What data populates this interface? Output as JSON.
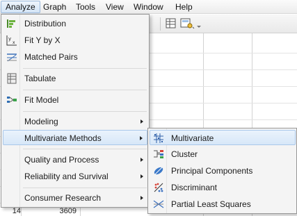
{
  "menubar": {
    "items": [
      "Analyze",
      "Graph",
      "Tools",
      "View",
      "Window",
      "Help"
    ]
  },
  "analyze_menu": {
    "items": [
      {
        "label": "Distribution",
        "icon": "distribution-icon"
      },
      {
        "label": "Fit Y by X",
        "icon": "fit-y-by-x-icon"
      },
      {
        "label": "Matched Pairs",
        "icon": "matched-pairs-icon"
      },
      {
        "label": "Tabulate",
        "icon": "tabulate-icon"
      },
      {
        "label": "Fit Model",
        "icon": "fit-model-icon"
      },
      {
        "label": "Modeling",
        "submenu": true
      },
      {
        "label": "Multivariate Methods",
        "submenu": true,
        "highlighted": true
      },
      {
        "label": "Quality and Process",
        "submenu": true
      },
      {
        "label": "Reliability and Survival",
        "submenu": true
      },
      {
        "label": "Consumer Research",
        "submenu": true
      }
    ]
  },
  "multivariate_submenu": {
    "items": [
      {
        "label": "Multivariate",
        "icon": "multivariate-icon",
        "highlighted": true
      },
      {
        "label": "Cluster",
        "icon": "cluster-icon"
      },
      {
        "label": "Principal Components",
        "icon": "principal-components-icon"
      },
      {
        "label": "Discriminant",
        "icon": "discriminant-icon"
      },
      {
        "label": "Partial Least Squares",
        "icon": "partial-least-squares-icon"
      }
    ]
  },
  "grid": {
    "visible_row": {
      "row": "14",
      "value": "3609"
    }
  },
  "colors": {
    "highlight": "#d7e7f8",
    "highlight_border": "#a9c7ea",
    "menu_bg": "#f4f4f4"
  }
}
